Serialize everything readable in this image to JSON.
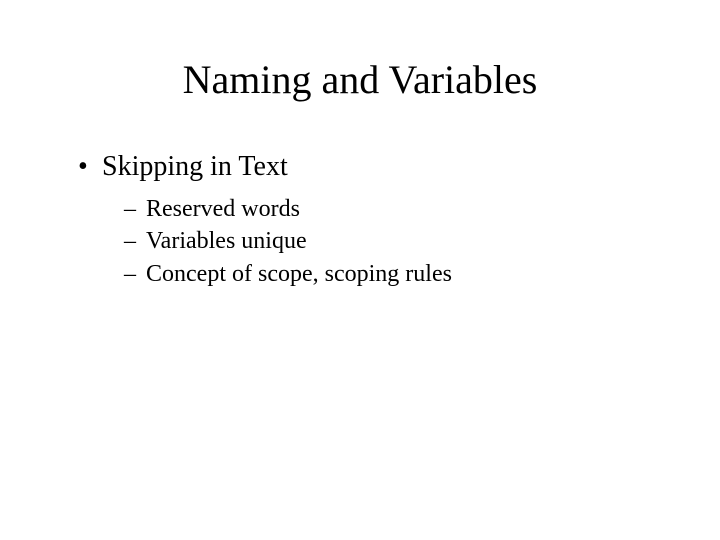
{
  "title": "Naming and Variables",
  "bullets": {
    "l1": {
      "b0": "Skipping in Text"
    },
    "l2": {
      "s0": "Reserved words",
      "s1": "Variables unique",
      "s2": "Concept of scope, scoping rules"
    }
  }
}
